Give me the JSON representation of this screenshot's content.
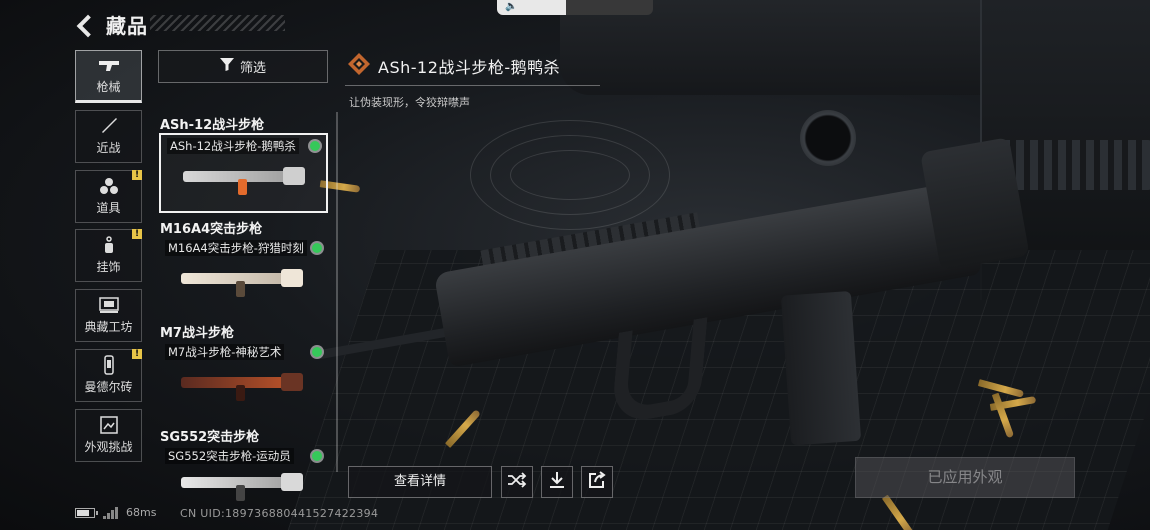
{
  "header": {
    "title": "藏品"
  },
  "categories": [
    {
      "label": "枪械",
      "icon": "gun-icon",
      "active": true,
      "alert": false
    },
    {
      "label": "近战",
      "icon": "knife-icon",
      "active": false,
      "alert": false
    },
    {
      "label": "道具",
      "icon": "grenade-icon",
      "active": false,
      "alert": true
    },
    {
      "label": "挂饰",
      "icon": "charm-icon",
      "active": false,
      "alert": true
    },
    {
      "label": "典藏工坊",
      "icon": "workshop-icon",
      "active": false,
      "alert": false
    },
    {
      "label": "曼德尔砖",
      "icon": "brick-icon",
      "active": false,
      "alert": true
    },
    {
      "label": "外观挑战",
      "icon": "challenge-icon",
      "active": false,
      "alert": false
    }
  ],
  "filter": {
    "label": "筛选",
    "icon": "filter-icon"
  },
  "weapon_groups": [
    {
      "title": "ASh-12战斗步枪",
      "skin": "ASh-12战斗步枪-鹅鸭杀",
      "selected": true,
      "owned": true,
      "colors": [
        "#d8d8d8",
        "#e36b2c"
      ]
    },
    {
      "title": "M16A4突击步枪",
      "skin": "M16A4突击步枪-狩猎时刻",
      "selected": false,
      "owned": true,
      "colors": [
        "#efe6d8",
        "#5a4a3a"
      ]
    },
    {
      "title": "M7战斗步枪",
      "skin": "M7战斗步枪-神秘艺术",
      "selected": false,
      "owned": true,
      "colors": [
        "#5a2a20",
        "#c0552a"
      ]
    },
    {
      "title": "SG552突击步枪",
      "skin": "SG552突击步枪-运动员",
      "selected": false,
      "owned": true,
      "colors": [
        "#e8e8e8",
        "#444"
      ]
    }
  ],
  "item": {
    "name": "ASh-12战斗步枪-鹅鸭杀",
    "description": "让伪装现形，令狡辩噤声",
    "icon": "diamond-badge-icon"
  },
  "actions": {
    "details_label": "查看详情",
    "shuffle_icon": "shuffle-icon",
    "download_icon": "download-icon",
    "share_icon": "share-icon",
    "apply_label": "已应用外观"
  },
  "status": {
    "ping": "68ms",
    "uid": "CN UID:189736880441527422394"
  },
  "volume_level": 0.44
}
